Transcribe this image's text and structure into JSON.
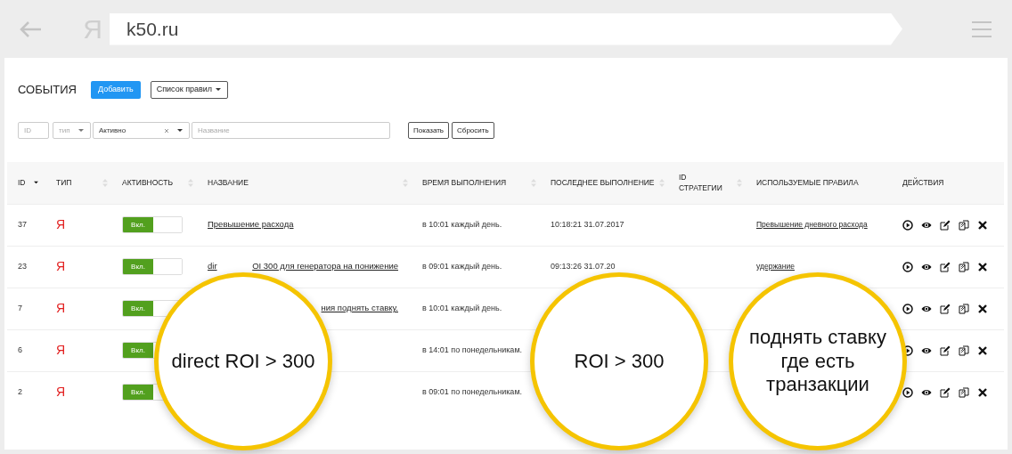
{
  "browser": {
    "logo": "Я",
    "address": "k50.ru"
  },
  "page": {
    "title": "СОБЫТИЯ",
    "add_button": "Добавить",
    "rules_dropdown": "Список правил"
  },
  "filters": {
    "id": {
      "placeholder": "ID"
    },
    "type": {
      "placeholder": "тип"
    },
    "activity": {
      "value": "Активно"
    },
    "name": {
      "placeholder": "Название"
    },
    "buttons": [
      "Показать",
      "Сбросить"
    ]
  },
  "table": {
    "columns": [
      {
        "label": "ID",
        "sorted": true
      },
      {
        "label": "ТИП",
        "sorted": false
      },
      {
        "label": "АКТИВНОСТЬ",
        "sorted": false
      },
      {
        "label": "НАЗВАНИЕ",
        "sorted": false
      },
      {
        "label": "ВРЕМЯ ВЫПОЛНЕНИЯ",
        "sorted": false
      },
      {
        "label": "ПОСЛЕДНЕЕ ВЫПОЛНЕНИЕ",
        "sorted": false
      },
      {
        "label": "ID СТРАТЕГИИ",
        "sorted": false
      },
      {
        "label": "ИСПОЛЬЗУЕМЫЕ ПРАВИЛА"
      },
      {
        "label": "ДЕЙСТВИЯ"
      }
    ],
    "rows": [
      {
        "id": "37",
        "type": "Я",
        "toggle": {
          "on": true,
          "label": "Вкл."
        },
        "name": {
          "covered": false,
          "visible": [
            "Превышение расхода"
          ]
        },
        "schedule": "в 10:01 каждый день.",
        "last_run": "10:18:21 31.07.2017",
        "rules": "Превышение дневного расхода"
      },
      {
        "id": "23",
        "type": "Я",
        "toggle": {
          "on": true,
          "label": "Вкл."
        },
        "name": {
          "covered": true,
          "visible": [
            "dir",
            "OI 300 для генератора на понижение"
          ]
        },
        "schedule": "в 09:01 каждый день.",
        "last_run": "09:13:26 31.07.20",
        "rules": "удержание"
      },
      {
        "id": "7",
        "type": "Я",
        "toggle": {
          "on": true,
          "label": "Вкл."
        },
        "name": {
          "covered": true,
          "visible": [
            "ния поднять ставку."
          ]
        },
        "schedule": "в 10:01 каждый день."
      },
      {
        "id": "6",
        "type": "Я",
        "toggle": {
          "on": true,
          "label": "Вкл."
        },
        "schedule": "в 14:01 по понедельникам."
      },
      {
        "id": "2",
        "type": "Я",
        "toggle": {
          "on": true,
          "label": "Вкл."
        },
        "schedule": "в 09:01 по понедельникам."
      }
    ]
  },
  "callouts": [
    {
      "text": "direct ROI > 300"
    },
    {
      "text": "ROI > 300"
    },
    {
      "text": "поднять ставку где есть транзакции"
    }
  ]
}
